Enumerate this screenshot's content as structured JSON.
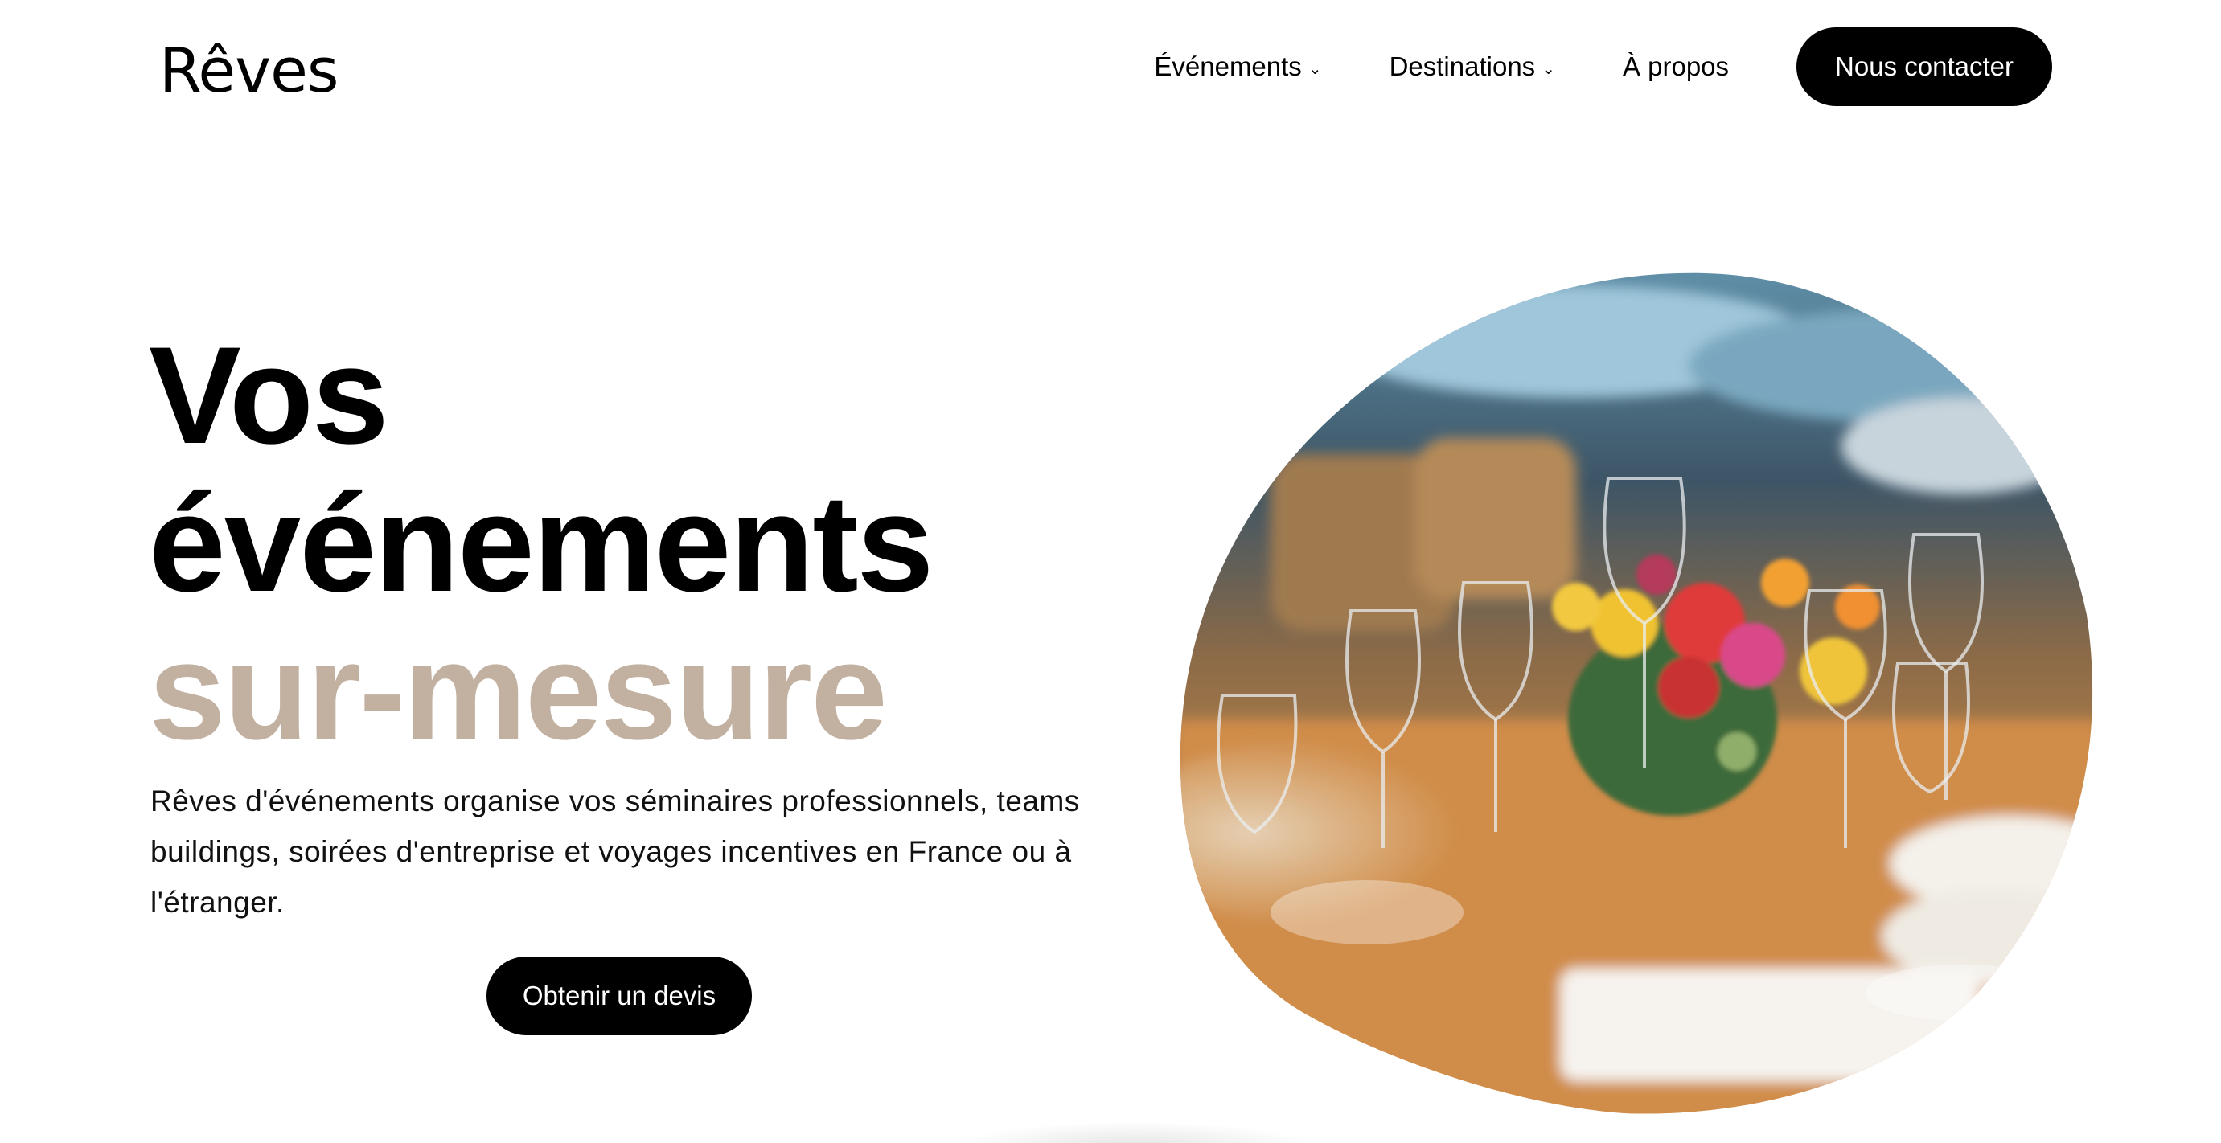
{
  "brand": {
    "logo_text": "Rêves"
  },
  "nav": {
    "items": [
      {
        "label": "Événements",
        "has_dropdown": true
      },
      {
        "label": "Destinations",
        "has_dropdown": true
      },
      {
        "label": "À propos",
        "has_dropdown": false
      }
    ],
    "cta_label": "Nous contacter"
  },
  "hero": {
    "title_line1": "Vos",
    "title_line2": "événements",
    "title_line3": "sur-mesure",
    "description": "Rêves d'événements organise vos séminaires professionnels, teams buildings, soirées d'entreprise et voyages incentives en France ou à l'étranger.",
    "cta_label": "Obtenir un devis",
    "accent_color": "#c2b1a1"
  },
  "icons": {
    "dropdown": "chevron-down-icon"
  }
}
